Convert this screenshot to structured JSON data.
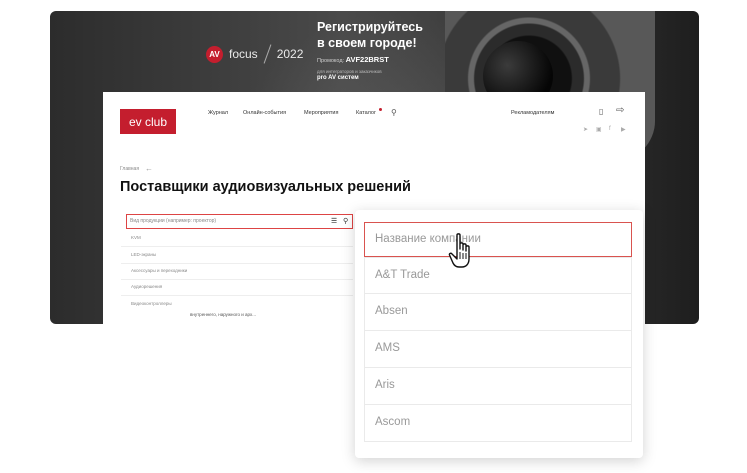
{
  "banner": {
    "focus_badge": "AV",
    "focus_word": "focus",
    "focus_year": "2022",
    "promo_title_line1": "Регистрируйтесь",
    "promo_title_line2": "в своем городе!",
    "promo_code_label": "Промокод:",
    "promo_code": "AVF22BRST",
    "promo_note_line1": "для интеграторов и заказчиков",
    "promo_note_line2": "pro AV систем"
  },
  "site": {
    "logo": "ev club",
    "nav": [
      "Журнал",
      "Онлайн-события",
      "Мероприятия",
      "Каталог"
    ],
    "advertisers": "Рекламодателям",
    "breadcrumb": "Главная",
    "page_title": "Поставщики аудиовизуальных решений",
    "product_search_placeholder": "Вид продукции (например: проектор)",
    "categories": [
      "KVM",
      "LED-экраны",
      "Аксессуары и переходники",
      "Аудиорешения",
      "Видеоконтроллеры"
    ],
    "desc_snippet": "внутреннего, наружного и арх..."
  },
  "dropdown": {
    "placeholder": "Название компании",
    "companies": [
      "A&T Trade",
      "Absen",
      "AMS",
      "Aris",
      "Ascom"
    ]
  },
  "colors": {
    "accent": "#c41e2e",
    "border_active": "#d9534f"
  }
}
